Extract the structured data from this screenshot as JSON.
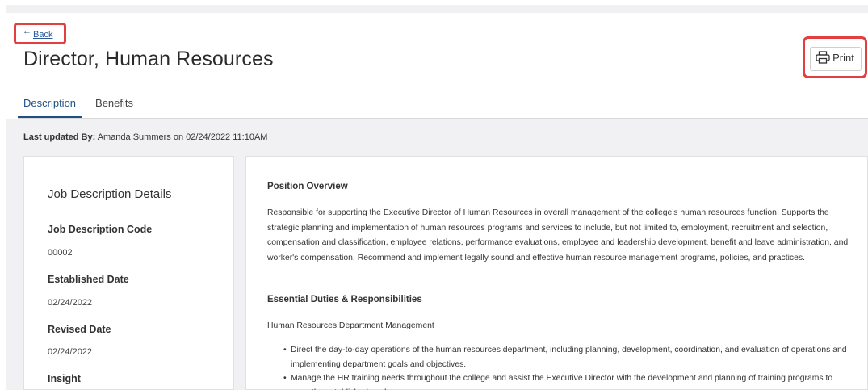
{
  "nav": {
    "back_label": "Back",
    "back_arrow": "←"
  },
  "page": {
    "title": "Director, Human Resources"
  },
  "toolbar": {
    "print_label": "Print",
    "print_icon": "printer-icon"
  },
  "tabs": [
    {
      "label": "Description",
      "active": true
    },
    {
      "label": "Benefits",
      "active": false
    }
  ],
  "last_updated": {
    "label": "Last updated By:",
    "value": "Amanda Summers on 02/24/2022 11:10AM"
  },
  "details": {
    "title": "Job Description Details",
    "fields": [
      {
        "label": "Job Description Code",
        "value": "00002"
      },
      {
        "label": "Established Date",
        "value": "02/24/2022"
      },
      {
        "label": "Revised Date",
        "value": "02/24/2022"
      },
      {
        "label": "Insight",
        "value": ""
      }
    ]
  },
  "description": {
    "overview_heading": "Position Overview",
    "overview_text": "Responsible for supporting the Executive Director of Human Resources in overall management of the college's human resources function.  Supports the strategic planning and implementation of human resources programs and services to include, but not limited to, employment, recruitment and selection, compensation and classification, employee relations, performance evaluations, employee and leadership development, benefit and leave administration, and worker's compensation.  Recommend and implement legally sound and effective human resource management programs, policies, and practices.",
    "duties_heading": "Essential Duties & Responsibilities",
    "duties_subheading": "Human Resources Department Management",
    "duties": [
      "Direct the day-to-day operations of the human resources department, including planning, development, coordination, and evaluation of operations and implementing department goals and objectives.",
      "Manage the HR training needs throughout the college and assist the Executive Director with the development and planning of training programs to meet the established goals."
    ]
  },
  "colors": {
    "accent": "#1f4f85",
    "highlight": "#e43f3f",
    "background": "#f1f1f3"
  }
}
